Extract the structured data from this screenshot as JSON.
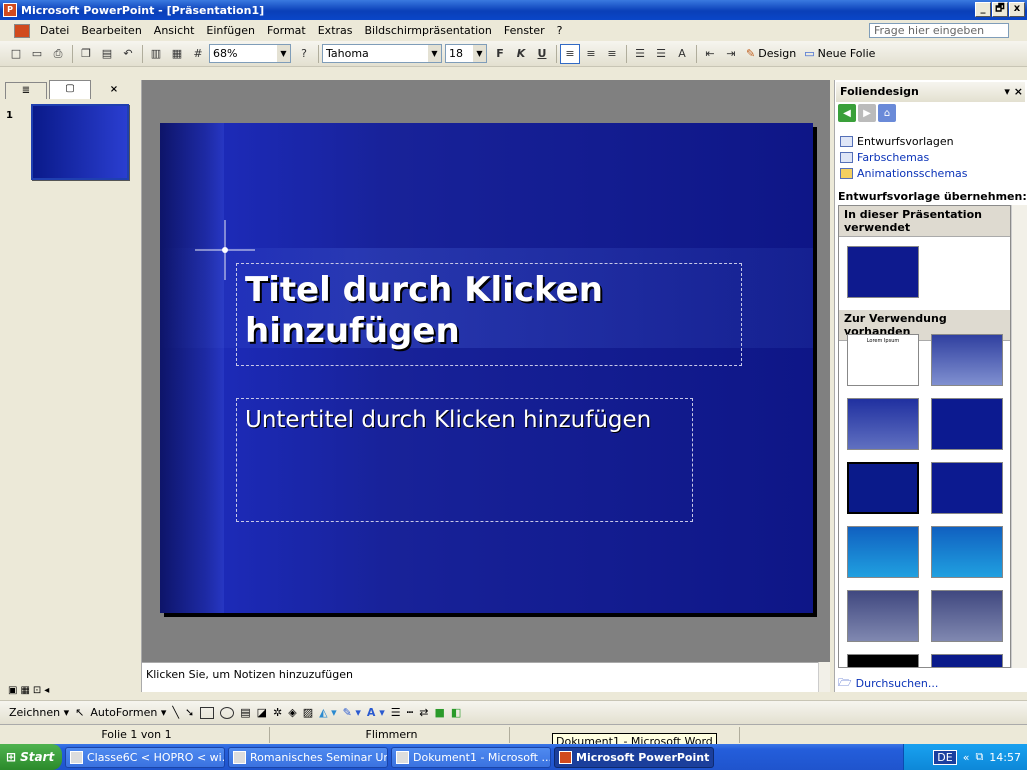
{
  "window": {
    "title": "Microsoft PowerPoint - [Präsentation1]",
    "app_icon": "powerpoint-icon",
    "buttons": [
      "_",
      "🗗",
      "x"
    ]
  },
  "menu": {
    "items": [
      "Datei",
      "Bearbeiten",
      "Ansicht",
      "Einfügen",
      "Format",
      "Extras",
      "Bildschirmpräsentation",
      "Fenster",
      "?"
    ],
    "ask_placeholder": "Frage hier eingeben"
  },
  "toolbar": {
    "zoom": "68%",
    "font": "Tahoma",
    "font_size": "18",
    "bold": "F",
    "italic": "K",
    "underline": "U",
    "design_label": "Design",
    "new_slide_label": "Neue Folie"
  },
  "slides_panel": {
    "slide_number": "1"
  },
  "slide": {
    "title": "Titel durch Klicken hinzufügen",
    "subtitle": "Untertitel durch Klicken hinzufügen"
  },
  "notes": {
    "placeholder": "Klicken Sie, um Notizen hinzuzufügen"
  },
  "task_pane": {
    "title": "Foliendesign",
    "links": [
      "Entwurfsvorlagen",
      "Farbschemas",
      "Animationsschemas"
    ],
    "apply_heading": "Entwurfsvorlage übernehmen:",
    "group_used": "In dieser Präsentation verwendet",
    "group_available": "Zur Verwendung vorhanden",
    "template_heading_text": "Lorem Ipsum",
    "browse": "Durchsuchen..."
  },
  "drawing_toolbar": {
    "draw_label": "Zeichnen",
    "autoshapes_label": "AutoFormen"
  },
  "status": {
    "slide_info": "Folie 1 von 1",
    "design": "Flimmern"
  },
  "tooltip": "Dokument1 - Microsoft Word",
  "taskbar": {
    "start": "Start",
    "tasks": [
      "Classe6C < HOPRO < wi...",
      "Romanisches Seminar Un...",
      "Dokument1 - Microsoft ...",
      "Microsoft PowerPoint ..."
    ],
    "lang": "DE",
    "time": "14:57"
  }
}
